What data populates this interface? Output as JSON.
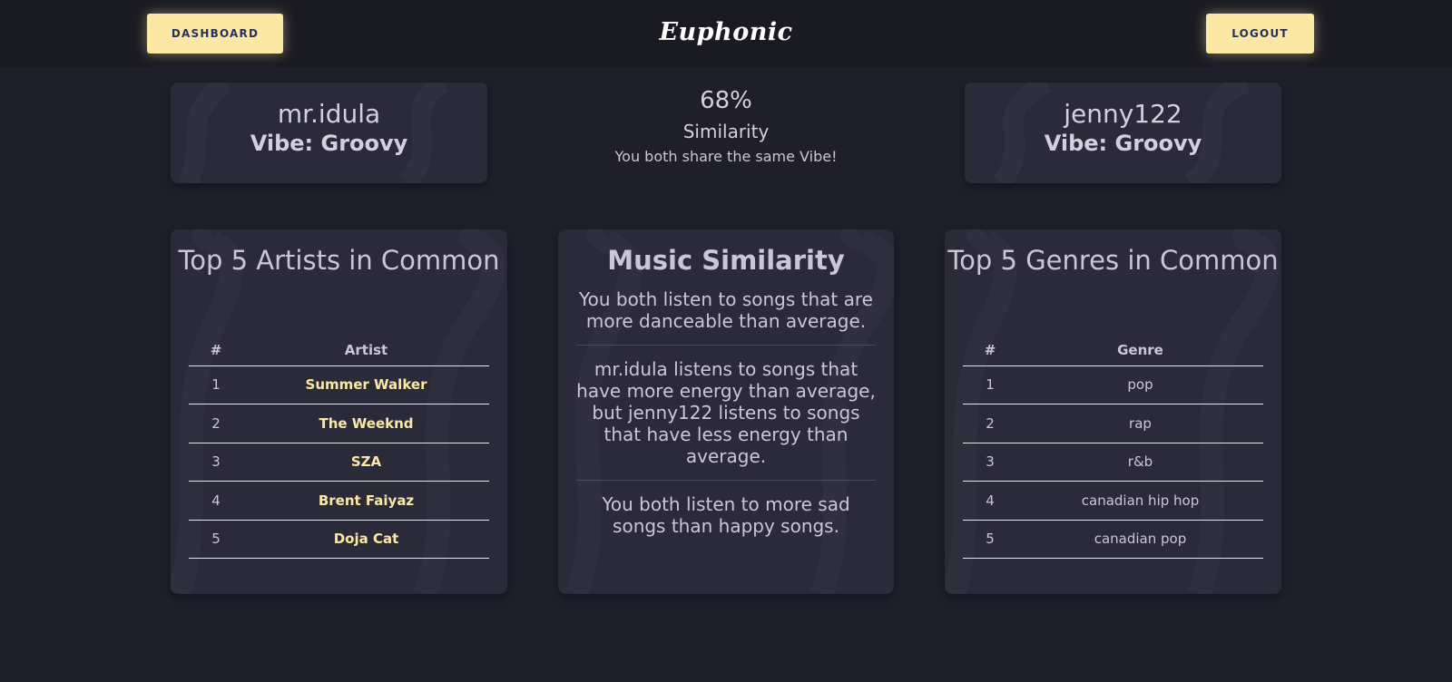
{
  "header": {
    "dashboard_label": "DASHBOARD",
    "logo_text": "Euphonic",
    "logout_label": "LOGOUT"
  },
  "user_left": {
    "name": "mr.idula",
    "vibe": "Vibe: Groovy"
  },
  "user_right": {
    "name": "jenny122",
    "vibe": "Vibe: Groovy"
  },
  "similarity": {
    "percent": "68%",
    "label": "Similarity",
    "note": "You both share the same Vibe!"
  },
  "artists_panel": {
    "title": "Top 5 Artists in Common",
    "col_num": "#",
    "col_name": "Artist",
    "rows": [
      {
        "num": "1",
        "name": "Summer Walker"
      },
      {
        "num": "2",
        "name": "The Weeknd"
      },
      {
        "num": "3",
        "name": "SZA"
      },
      {
        "num": "4",
        "name": "Brent Faiyaz"
      },
      {
        "num": "5",
        "name": "Doja Cat"
      }
    ]
  },
  "music_panel": {
    "title": "Music Similarity",
    "items": [
      "You both listen to songs that are more danceable than average.",
      "mr.idula listens to songs that have more energy than average, but jenny122 listens to songs that have less energy than average.",
      "You both listen to more sad songs than happy songs."
    ]
  },
  "genres_panel": {
    "title": "Top 5 Genres in Common",
    "col_num": "#",
    "col_name": "Genre",
    "rows": [
      {
        "num": "1",
        "name": "pop"
      },
      {
        "num": "2",
        "name": "rap"
      },
      {
        "num": "3",
        "name": "r&b"
      },
      {
        "num": "4",
        "name": "canadian hip hop"
      },
      {
        "num": "5",
        "name": "canadian pop"
      }
    ]
  },
  "colors": {
    "background": "#1f1f2b",
    "topbar": "#1a1a23",
    "card": "#2a2a39",
    "accent": "#fde7a4",
    "button_text": "#27315a"
  }
}
